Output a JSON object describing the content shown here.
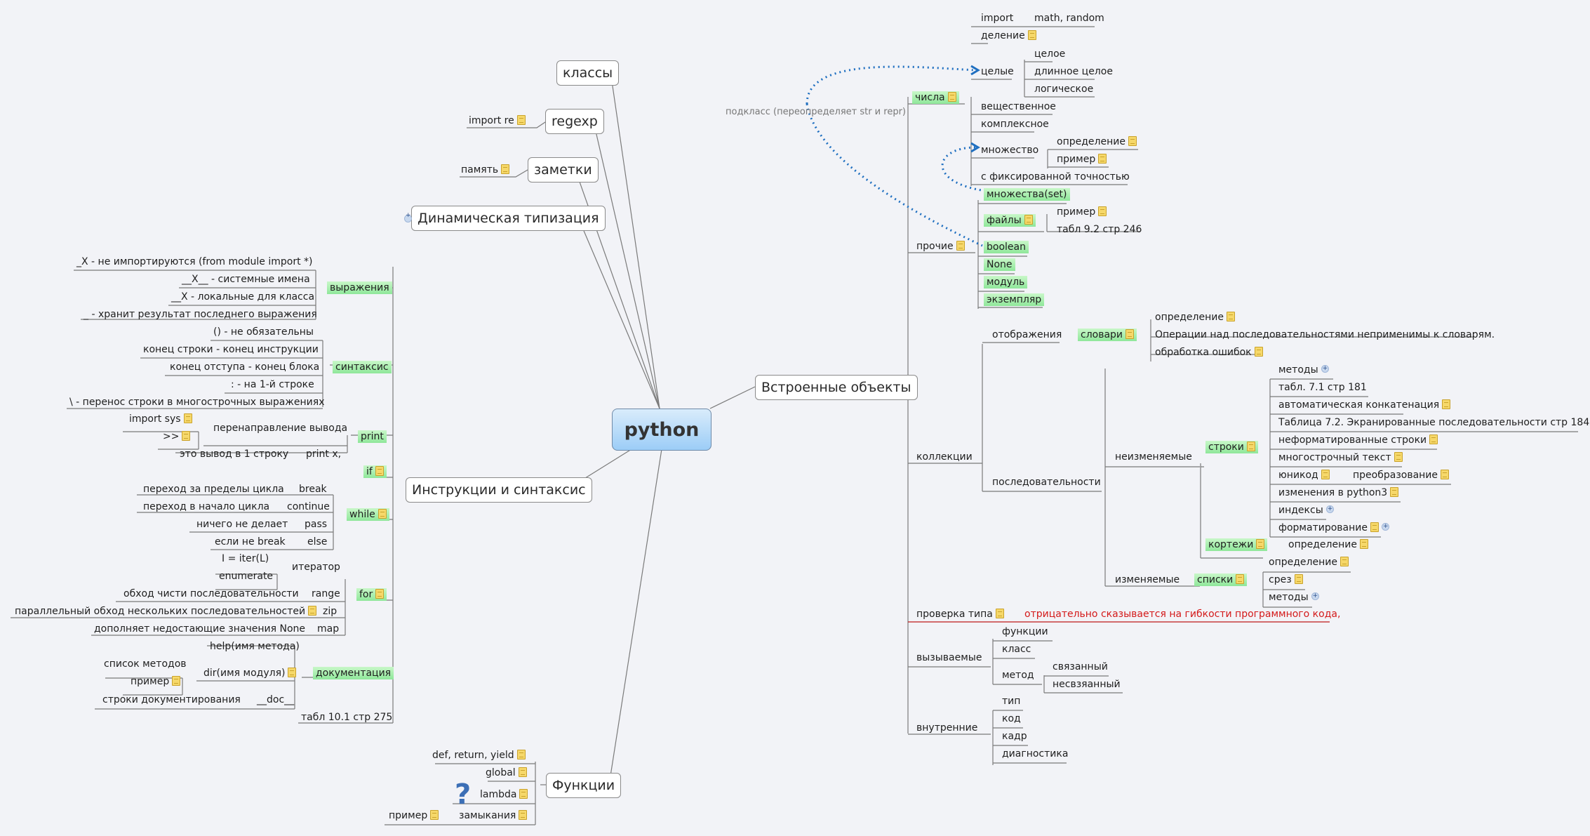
{
  "root": "python",
  "relationship_label": "подкласс (переопределяет str и repr)",
  "topics": {
    "classes": "классы",
    "regexp": {
      "label": "regexp",
      "children": [
        "import re"
      ]
    },
    "notes": {
      "label": "заметки",
      "children": [
        "память"
      ]
    },
    "dyn": "Динамическая типизация",
    "instr": {
      "label": "Инструкции и синтаксис",
      "expr": {
        "label": "выражения",
        "children": [
          "_X - не импортируются (from module import *)",
          "__X__ - системные имена",
          "__X - локальные для класса",
          "_ - хранит результат последнего выражения"
        ]
      },
      "syntax": {
        "label": "синтаксис",
        "children": [
          "() - не обязательны",
          "конец строки - конец инструкции",
          "конец отступа - конец блока",
          ": - на 1-й строке",
          "\\ - перенос строки в многострочных выражениях"
        ]
      },
      "print": {
        "label": "print",
        "redirect": "перенаправление вывода",
        "redirect_children": [
          "import sys",
          ">>"
        ],
        "oneline_note": "это вывод в 1 строку",
        "oneline": "print x,"
      },
      "if": "if",
      "while": {
        "label": "while",
        "items": [
          {
            "desc": "переход за пределы цикла",
            "kw": "break"
          },
          {
            "desc": "переход в начало цикла",
            "kw": "continue"
          },
          {
            "desc": "ничего не делает",
            "kw": "pass"
          },
          {
            "desc": "если не break",
            "kw": "else"
          }
        ]
      },
      "for": {
        "label": "for",
        "iterator": "итератор",
        "iterator_children": [
          "I = iter(L)",
          "enumerate"
        ],
        "items": [
          {
            "desc": "обход чисти последовательности",
            "kw": "range"
          },
          {
            "desc": "параллельный обход нескольких последовательностей",
            "kw": "zip"
          },
          {
            "desc": "дополняет недостающие значения None",
            "kw": "map"
          }
        ]
      },
      "doc": {
        "label": "документация",
        "help": "help(имя метода)",
        "dir": "dir(имя модуля)",
        "dir_children": [
          "список методов",
          "пример"
        ],
        "docstr_desc": "строки документирования",
        "docstr": "__doc__"
      },
      "table": "табл 10.1 стр 275"
    },
    "func": {
      "label": "Функции",
      "children": [
        "def, return, yield",
        "global",
        "lambda",
        "замыкания"
      ],
      "closure_child": "пример"
    },
    "builtin": {
      "label": "Встроенные объекты",
      "numbers": {
        "label": "числа",
        "import": "import",
        "import_val": "math, random",
        "division": "деление",
        "integers": "целые",
        "int_children": [
          "целое",
          "длинное целое",
          "логическое"
        ],
        "real": "вещественное",
        "complex": "комплексное",
        "set": "множество",
        "set_children": [
          "определение",
          "пример"
        ],
        "fixed": "с фиксированной точностью"
      },
      "other": {
        "label": "прочие",
        "sets": "множества(set)",
        "files": "файлы",
        "files_children": [
          "пример",
          "табл 9.2 стр 246"
        ],
        "rest": [
          "boolean",
          "None",
          "модуль",
          "экземпляр"
        ]
      },
      "collections": {
        "label": "коллекции",
        "mappings": "отображения",
        "dicts": "словари",
        "dict_children": [
          "определение",
          "Операции над последовательностями неприменимы к словарям.",
          "обработка ошибок"
        ],
        "sequences": "последовательности",
        "immutable": "неизменяемые",
        "strings": "строки",
        "string_children": [
          "методы",
          "табл. 7.1 стр 181",
          "автоматическая конкатенация",
          "Таблица 7.2. Экранированные последовательности стр 184",
          "неформатированные строки",
          "многострочный текст",
          "юникод",
          "изменения в python3",
          "индексы",
          "форматирование"
        ],
        "unicode_child": "преобразование",
        "tuples": "кортежи",
        "tuple_child": "определение",
        "mutable": "изменяемые",
        "lists": "списки",
        "list_children": [
          "определение",
          "срез",
          "методы"
        ]
      },
      "typecheck": {
        "label": "проверка типа",
        "child": "отрицательно сказывается на гибкости программного кода,"
      },
      "callable": {
        "label": "вызываемые",
        "children": [
          "функции",
          "класс",
          "метод"
        ],
        "method_children": [
          "связанный",
          "несвзяанный"
        ]
      },
      "internal": {
        "label": "внутренние",
        "children": [
          "тип",
          "код",
          "кадр",
          "диагностика"
        ]
      }
    }
  },
  "colors": {
    "accent_green": "#8fe79a",
    "root_blue": "#9ccdf7",
    "relationship_blue": "#1f6fc0",
    "warning_red": "#d41a1a"
  }
}
